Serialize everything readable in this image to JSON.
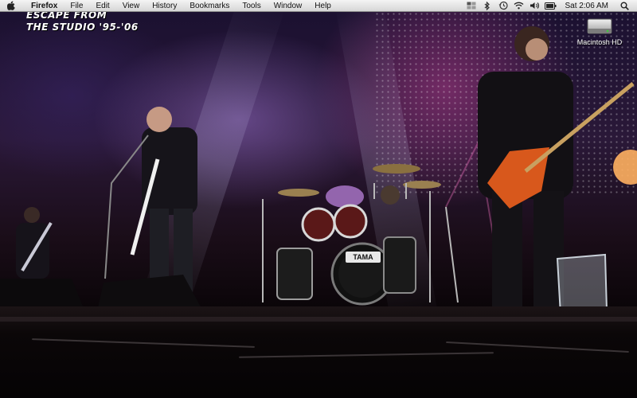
{
  "menubar": {
    "app_name": "Firefox",
    "menus": [
      "File",
      "Edit",
      "View",
      "History",
      "Bookmarks",
      "Tools",
      "Window",
      "Help"
    ],
    "status_icons": [
      "spaces-icon",
      "bluetooth-icon",
      "time-machine-icon",
      "wifi-icon",
      "volume-icon",
      "battery-icon"
    ],
    "clock": "Sat 2:06 AM",
    "spotlight_icon": "spotlight-search-icon"
  },
  "desktop": {
    "overlay_title": [
      "ESCAPE FROM",
      "THE STUDIO '95-'06"
    ],
    "drive_icon_label": "Macintosh HD",
    "drum_logo": "TAMA"
  },
  "colors": {
    "menubar_top": "#f4f4f4",
    "menubar_bottom": "#d6d6d6",
    "stage_purple": "#6b3a8c",
    "stage_magenta": "#b43c8c"
  }
}
